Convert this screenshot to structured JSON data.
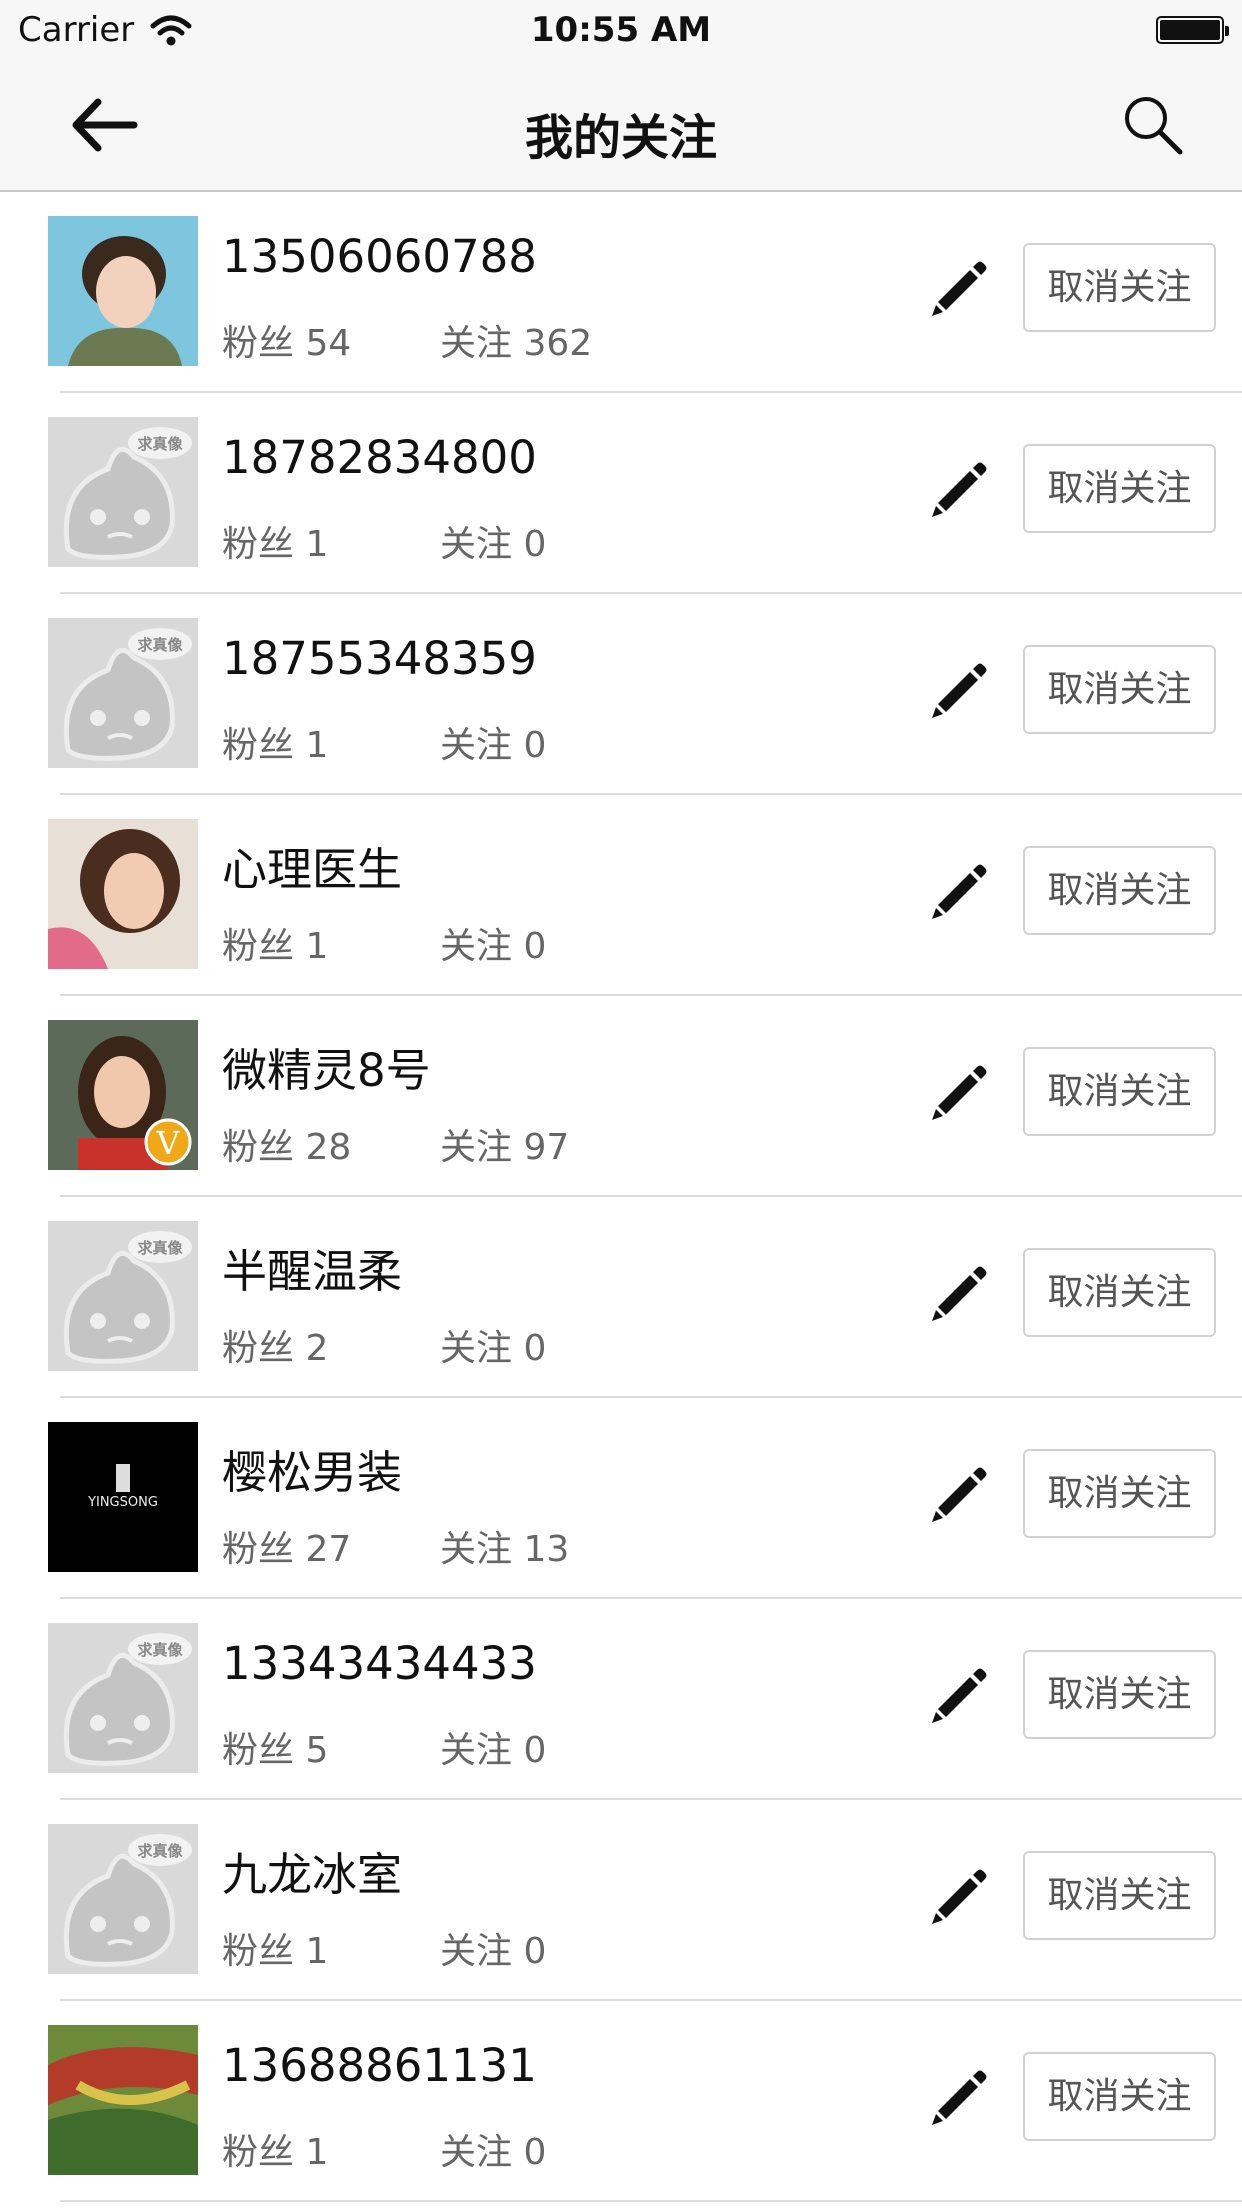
{
  "status_bar": {
    "carrier": "Carrier",
    "time": "10:55 AM"
  },
  "nav": {
    "title": "我的关注",
    "back_icon": "arrow-left-icon",
    "search_icon": "search-icon"
  },
  "colors": {
    "nav_background": "#f7f7f7",
    "divider": "#dcdcdc",
    "muted_text": "#666666"
  },
  "list": {
    "items": [
      {
        "name": "13506060788",
        "fans": "粉丝 54",
        "follows": "关注 362",
        "button": "取消关注",
        "avatar": "photo-woman-1"
      },
      {
        "name": "18782834800",
        "fans": "粉丝 1",
        "follows": "关注 0",
        "button": "取消关注",
        "avatar": "default-avatar",
        "avatar_badge_text": "求真像"
      },
      {
        "name": "18755348359",
        "fans": "粉丝 1",
        "follows": "关注 0",
        "button": "取消关注",
        "avatar": "default-avatar",
        "avatar_badge_text": "求真像"
      },
      {
        "name": "心理医生",
        "fans": "粉丝 1",
        "follows": "关注 0",
        "button": "取消关注",
        "avatar": "photo-woman-2"
      },
      {
        "name": "微精灵8号",
        "fans": "粉丝 28",
        "follows": "关注 97",
        "button": "取消关注",
        "avatar": "photo-woman-3-verified",
        "avatar_badge_text": "V"
      },
      {
        "name": "半醒温柔",
        "fans": "粉丝 2",
        "follows": "关注 0",
        "button": "取消关注",
        "avatar": "default-avatar",
        "avatar_badge_text": "求真像"
      },
      {
        "name": "樱松男装",
        "fans": "粉丝 27",
        "follows": "关注 13",
        "button": "取消关注",
        "avatar": "brand-logo",
        "avatar_badge_text": "YINGSONG"
      },
      {
        "name": "13343434433",
        "fans": "粉丝 5",
        "follows": "关注 0",
        "button": "取消关注",
        "avatar": "default-avatar",
        "avatar_badge_text": "求真像"
      },
      {
        "name": "九龙冰室",
        "fans": "粉丝 1",
        "follows": "关注 0",
        "button": "取消关注",
        "avatar": "default-avatar",
        "avatar_badge_text": "求真像"
      },
      {
        "name": "13688861131",
        "fans": "粉丝 1",
        "follows": "关注 0",
        "button": "取消关注",
        "avatar": "photo-abstract"
      }
    ]
  }
}
